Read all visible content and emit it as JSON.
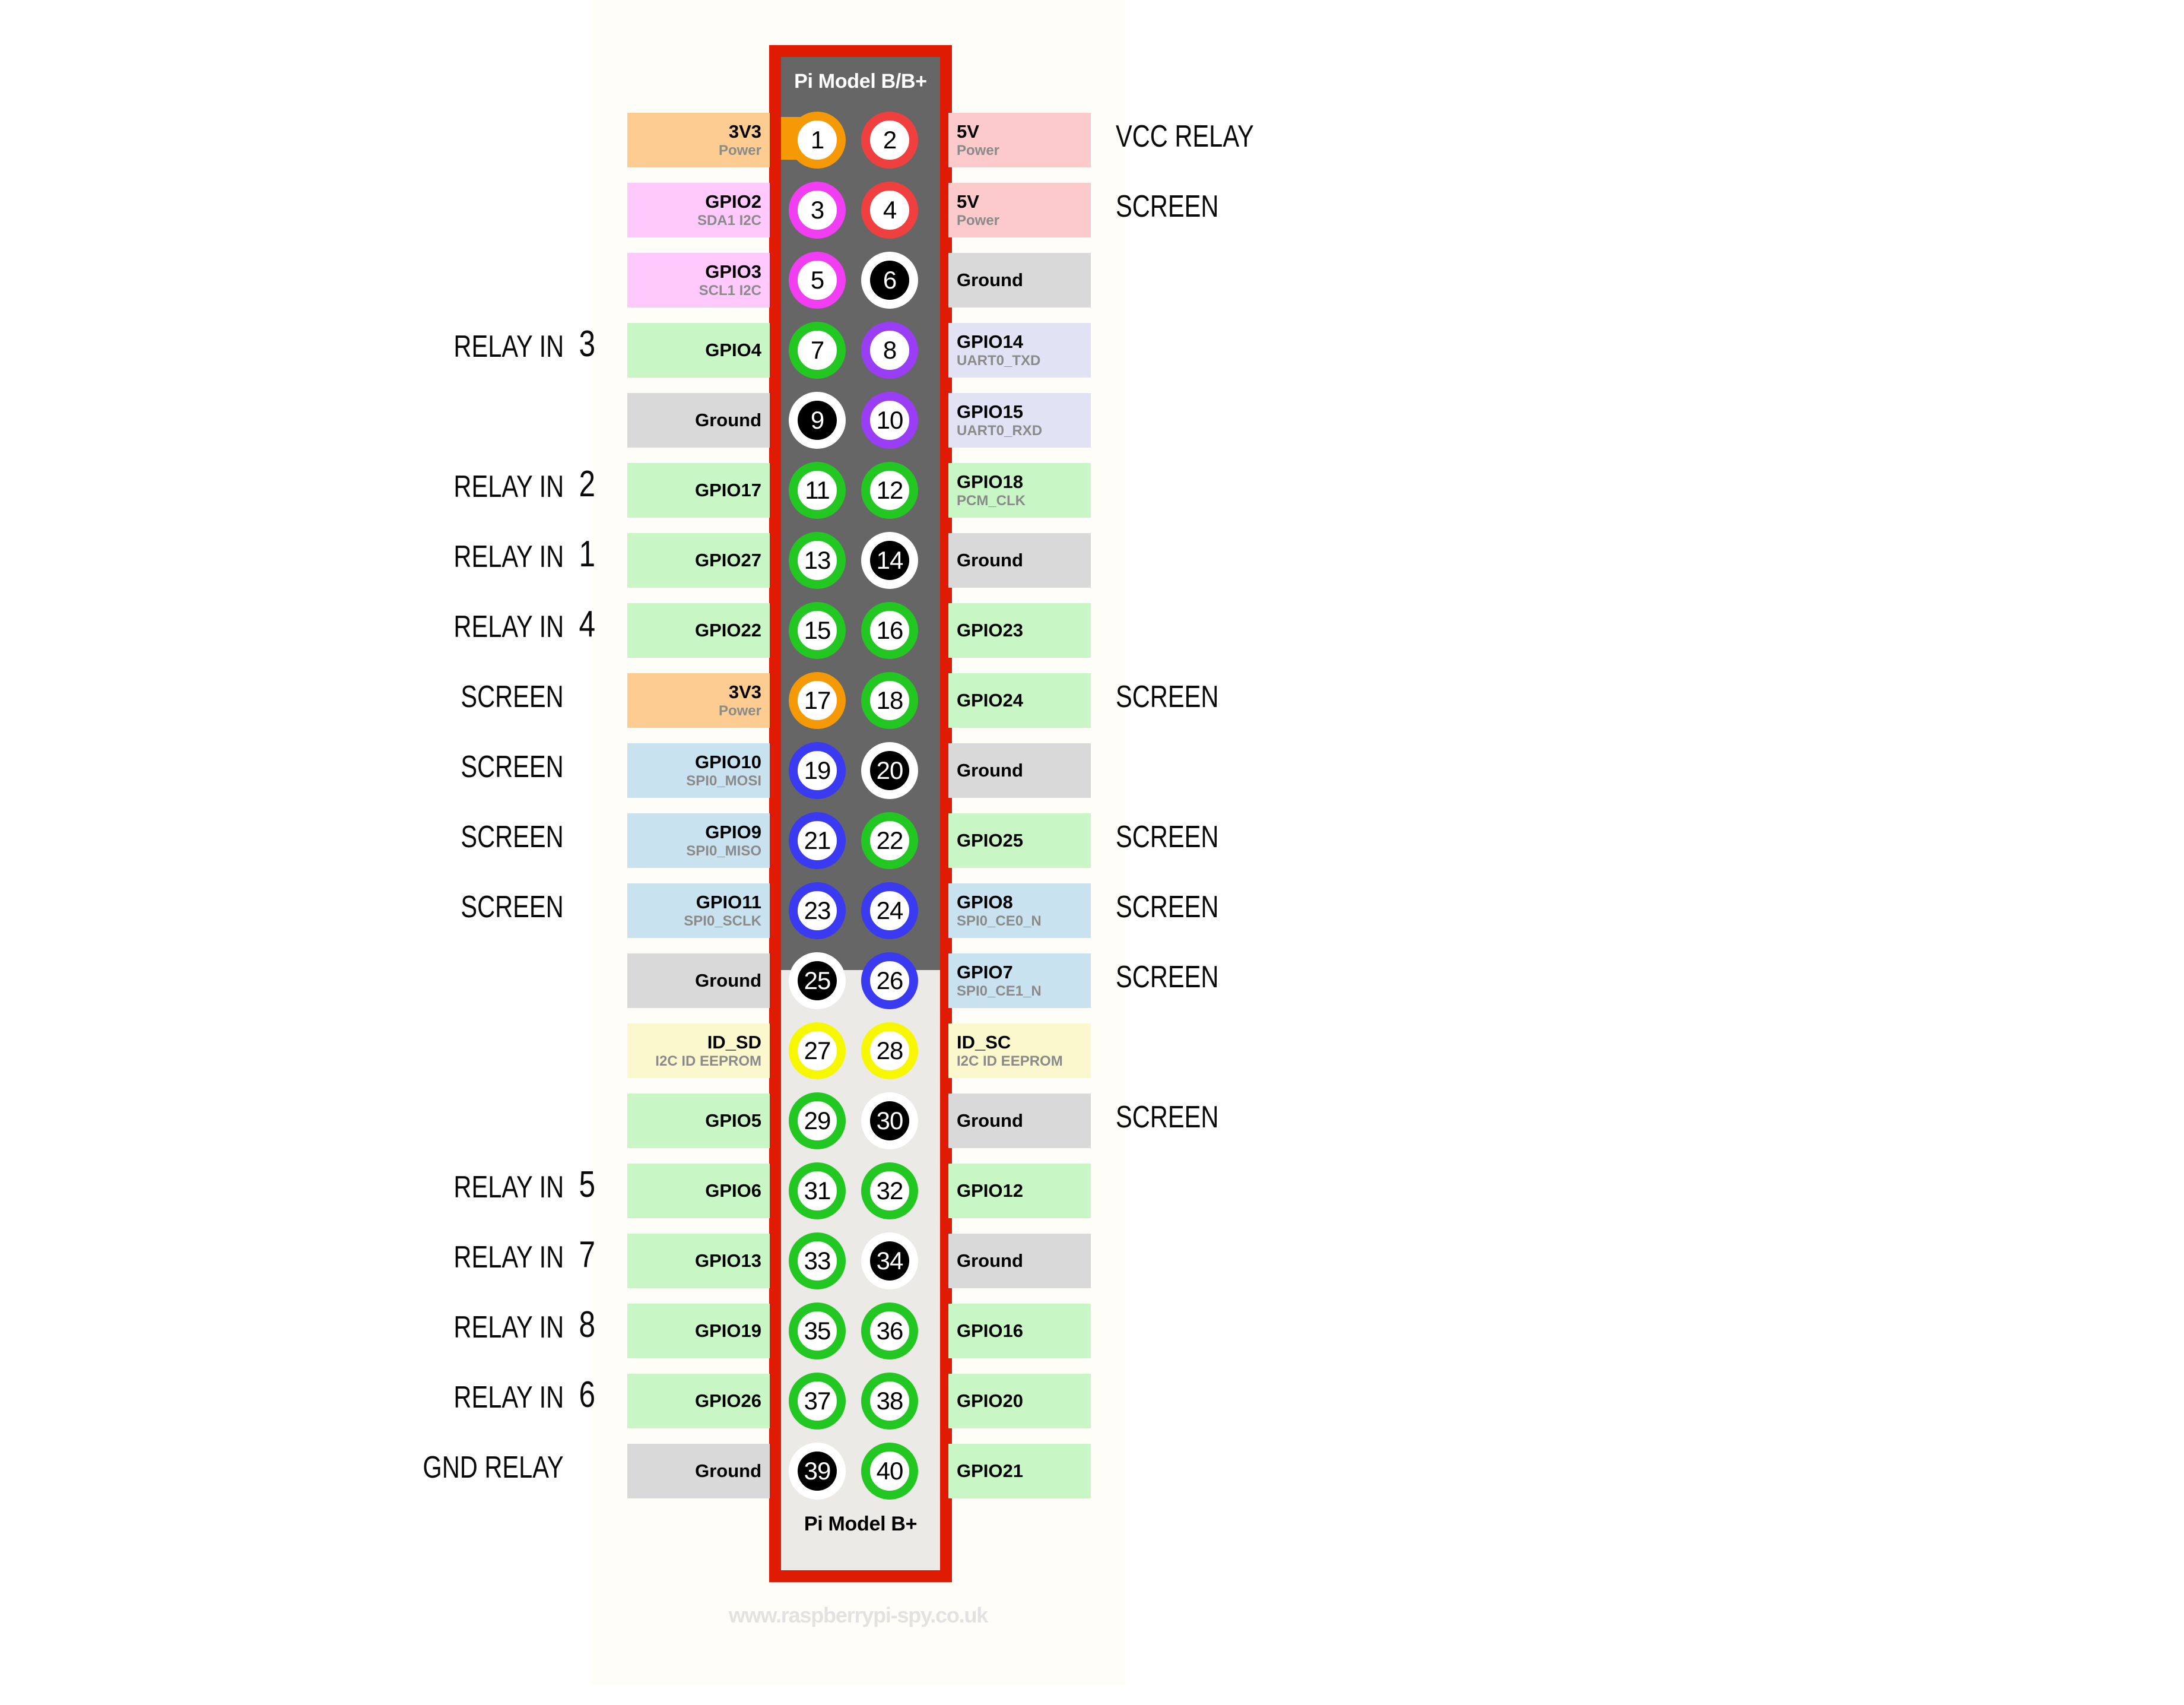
{
  "board": {
    "caption_top": "Pi Model B/B+",
    "caption_bottom": "Pi Model B+",
    "watermark": "www.raspberrypi-spy.co.uk",
    "outline_color": "#e01b04",
    "header_dark_color": "#666666",
    "header_light_color": "#eceae7"
  },
  "legend_colors": {
    "power_3v3": "#fccc91",
    "power_5v": "#fccaca",
    "ground": "#d9d9d9",
    "gpio": "#c8f7c5",
    "i2c": "#ffc9fb",
    "uart": "#e2e2f5",
    "spi": "#c9e2f0",
    "eeprom": "#fbf8cd",
    "ring_orange": "#f59a06",
    "ring_red": "#f03f3f",
    "ring_magenta": "#f23ef2",
    "ring_green": "#22c722",
    "ring_purple": "#9a3ef5",
    "ring_blue": "#3a3af0",
    "ring_yellow": "#f7f700",
    "ring_black": "#000000"
  },
  "pins": [
    {
      "n": 1,
      "side": "left",
      "name": "3V3",
      "sub": "Power",
      "box": "#fccc91",
      "ring": "#f59a06",
      "gnd": false
    },
    {
      "n": 2,
      "side": "right",
      "name": "5V",
      "sub": "Power",
      "box": "#fccaca",
      "ring": "#f03f3f",
      "gnd": false
    },
    {
      "n": 3,
      "side": "left",
      "name": "GPIO2",
      "sub": "SDA1 I2C",
      "box": "#ffc9fb",
      "ring": "#f23ef2",
      "gnd": false
    },
    {
      "n": 4,
      "side": "right",
      "name": "5V",
      "sub": "Power",
      "box": "#fccaca",
      "ring": "#f03f3f",
      "gnd": false
    },
    {
      "n": 5,
      "side": "left",
      "name": "GPIO3",
      "sub": "SCL1 I2C",
      "box": "#ffc9fb",
      "ring": "#f23ef2",
      "gnd": false
    },
    {
      "n": 6,
      "side": "right",
      "name": "Ground",
      "sub": "",
      "box": "#d9d9d9",
      "ring": "#000000",
      "gnd": true
    },
    {
      "n": 7,
      "side": "left",
      "name": "GPIO4",
      "sub": "",
      "box": "#c8f7c5",
      "ring": "#22c722",
      "gnd": false
    },
    {
      "n": 8,
      "side": "right",
      "name": "GPIO14",
      "sub": "UART0_TXD",
      "box": "#e2e2f5",
      "ring": "#9a3ef5",
      "gnd": false
    },
    {
      "n": 9,
      "side": "left",
      "name": "Ground",
      "sub": "",
      "box": "#d9d9d9",
      "ring": "#000000",
      "gnd": true
    },
    {
      "n": 10,
      "side": "right",
      "name": "GPIO15",
      "sub": "UART0_RXD",
      "box": "#e2e2f5",
      "ring": "#9a3ef5",
      "gnd": false
    },
    {
      "n": 11,
      "side": "left",
      "name": "GPIO17",
      "sub": "",
      "box": "#c8f7c5",
      "ring": "#22c722",
      "gnd": false
    },
    {
      "n": 12,
      "side": "right",
      "name": "GPIO18",
      "sub": "PCM_CLK",
      "box": "#c8f7c5",
      "ring": "#22c722",
      "gnd": false
    },
    {
      "n": 13,
      "side": "left",
      "name": "GPIO27",
      "sub": "",
      "box": "#c8f7c5",
      "ring": "#22c722",
      "gnd": false
    },
    {
      "n": 14,
      "side": "right",
      "name": "Ground",
      "sub": "",
      "box": "#d9d9d9",
      "ring": "#000000",
      "gnd": true
    },
    {
      "n": 15,
      "side": "left",
      "name": "GPIO22",
      "sub": "",
      "box": "#c8f7c5",
      "ring": "#22c722",
      "gnd": false
    },
    {
      "n": 16,
      "side": "right",
      "name": "GPIO23",
      "sub": "",
      "box": "#c8f7c5",
      "ring": "#22c722",
      "gnd": false
    },
    {
      "n": 17,
      "side": "left",
      "name": "3V3",
      "sub": "Power",
      "box": "#fccc91",
      "ring": "#f59a06",
      "gnd": false
    },
    {
      "n": 18,
      "side": "right",
      "name": "GPIO24",
      "sub": "",
      "box": "#c8f7c5",
      "ring": "#22c722",
      "gnd": false
    },
    {
      "n": 19,
      "side": "left",
      "name": "GPIO10",
      "sub": "SPI0_MOSI",
      "box": "#c9e2f0",
      "ring": "#3a3af0",
      "gnd": false
    },
    {
      "n": 20,
      "side": "right",
      "name": "Ground",
      "sub": "",
      "box": "#d9d9d9",
      "ring": "#000000",
      "gnd": true
    },
    {
      "n": 21,
      "side": "left",
      "name": "GPIO9",
      "sub": "SPI0_MISO",
      "box": "#c9e2f0",
      "ring": "#3a3af0",
      "gnd": false
    },
    {
      "n": 22,
      "side": "right",
      "name": "GPIO25",
      "sub": "",
      "box": "#c8f7c5",
      "ring": "#22c722",
      "gnd": false
    },
    {
      "n": 23,
      "side": "left",
      "name": "GPIO11",
      "sub": "SPI0_SCLK",
      "box": "#c9e2f0",
      "ring": "#3a3af0",
      "gnd": false
    },
    {
      "n": 24,
      "side": "right",
      "name": "GPIO8",
      "sub": "SPI0_CE0_N",
      "box": "#c9e2f0",
      "ring": "#3a3af0",
      "gnd": false
    },
    {
      "n": 25,
      "side": "left",
      "name": "Ground",
      "sub": "",
      "box": "#d9d9d9",
      "ring": "#000000",
      "gnd": true
    },
    {
      "n": 26,
      "side": "right",
      "name": "GPIO7",
      "sub": "SPI0_CE1_N",
      "box": "#c9e2f0",
      "ring": "#3a3af0",
      "gnd": false
    },
    {
      "n": 27,
      "side": "left",
      "name": "ID_SD",
      "sub": "I2C ID EEPROM",
      "box": "#fbf8cd",
      "ring": "#f7f700",
      "gnd": false
    },
    {
      "n": 28,
      "side": "right",
      "name": "ID_SC",
      "sub": "I2C ID EEPROM",
      "box": "#fbf8cd",
      "ring": "#f7f700",
      "gnd": false
    },
    {
      "n": 29,
      "side": "left",
      "name": "GPIO5",
      "sub": "",
      "box": "#c8f7c5",
      "ring": "#22c722",
      "gnd": false
    },
    {
      "n": 30,
      "side": "right",
      "name": "Ground",
      "sub": "",
      "box": "#d9d9d9",
      "ring": "#000000",
      "gnd": true
    },
    {
      "n": 31,
      "side": "left",
      "name": "GPIO6",
      "sub": "",
      "box": "#c8f7c5",
      "ring": "#22c722",
      "gnd": false
    },
    {
      "n": 32,
      "side": "right",
      "name": "GPIO12",
      "sub": "",
      "box": "#c8f7c5",
      "ring": "#22c722",
      "gnd": false
    },
    {
      "n": 33,
      "side": "left",
      "name": "GPIO13",
      "sub": "",
      "box": "#c8f7c5",
      "ring": "#22c722",
      "gnd": false
    },
    {
      "n": 34,
      "side": "right",
      "name": "Ground",
      "sub": "",
      "box": "#d9d9d9",
      "ring": "#000000",
      "gnd": true
    },
    {
      "n": 35,
      "side": "left",
      "name": "GPIO19",
      "sub": "",
      "box": "#c8f7c5",
      "ring": "#22c722",
      "gnd": false
    },
    {
      "n": 36,
      "side": "right",
      "name": "GPIO16",
      "sub": "",
      "box": "#c8f7c5",
      "ring": "#22c722",
      "gnd": false
    },
    {
      "n": 37,
      "side": "left",
      "name": "GPIO26",
      "sub": "",
      "box": "#c8f7c5",
      "ring": "#22c722",
      "gnd": false
    },
    {
      "n": 38,
      "side": "right",
      "name": "GPIO20",
      "sub": "",
      "box": "#c8f7c5",
      "ring": "#22c722",
      "gnd": false
    },
    {
      "n": 39,
      "side": "left",
      "name": "Ground",
      "sub": "",
      "box": "#d9d9d9",
      "ring": "#000000",
      "gnd": true
    },
    {
      "n": 40,
      "side": "right",
      "name": "GPIO21",
      "sub": "",
      "box": "#c8f7c5",
      "ring": "#22c722",
      "gnd": false
    }
  ],
  "annotations_left": [
    {
      "pin": 7,
      "text": "RELAY IN",
      "num": "3"
    },
    {
      "pin": 11,
      "text": "RELAY IN",
      "num": "2"
    },
    {
      "pin": 13,
      "text": "RELAY IN",
      "num": "1"
    },
    {
      "pin": 15,
      "text": "RELAY IN",
      "num": "4"
    },
    {
      "pin": 17,
      "text": "SCREEN",
      "num": ""
    },
    {
      "pin": 19,
      "text": "SCREEN",
      "num": ""
    },
    {
      "pin": 21,
      "text": "SCREEN",
      "num": ""
    },
    {
      "pin": 23,
      "text": "SCREEN",
      "num": ""
    },
    {
      "pin": 31,
      "text": "RELAY IN",
      "num": "5"
    },
    {
      "pin": 33,
      "text": "RELAY IN",
      "num": "7"
    },
    {
      "pin": 35,
      "text": "RELAY IN",
      "num": "8"
    },
    {
      "pin": 37,
      "text": "RELAY IN",
      "num": "6"
    },
    {
      "pin": 39,
      "text": "GND RELAY",
      "num": ""
    }
  ],
  "annotations_right": [
    {
      "pin": 2,
      "text": "VCC RELAY"
    },
    {
      "pin": 4,
      "text": "SCREEN"
    },
    {
      "pin": 18,
      "text": "SCREEN"
    },
    {
      "pin": 22,
      "text": "SCREEN"
    },
    {
      "pin": 24,
      "text": "SCREEN"
    },
    {
      "pin": 26,
      "text": "SCREEN"
    },
    {
      "pin": 30,
      "text": "SCREEN"
    }
  ]
}
